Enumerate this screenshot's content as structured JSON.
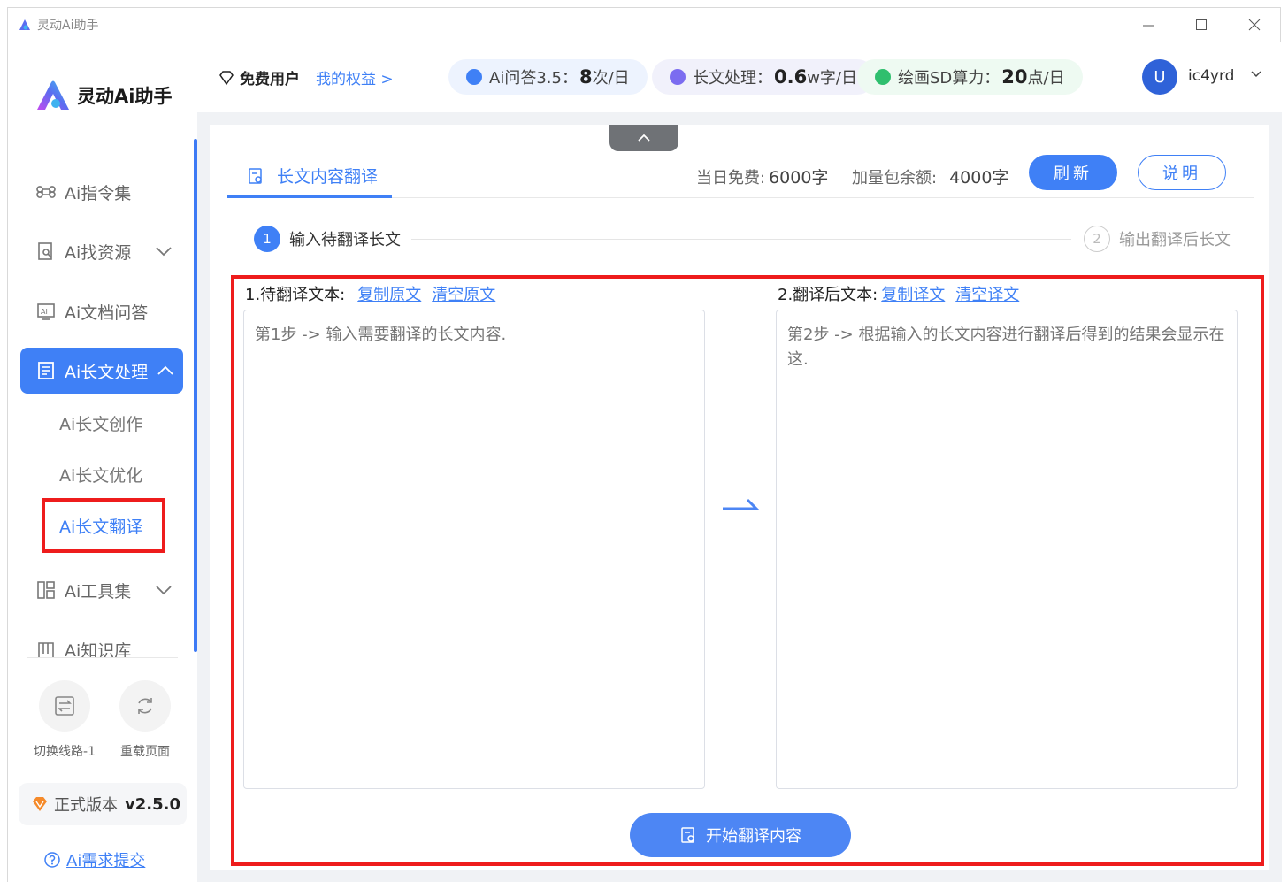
{
  "window": {
    "title": "灵动Ai助手",
    "controls": [
      "minimize-icon",
      "maximize-icon",
      "close-icon"
    ]
  },
  "sidebar": {
    "brand": "灵动Ai助手",
    "items": [
      {
        "label": "Ai指令集",
        "icon": "command-icon"
      },
      {
        "label": "Ai找资源",
        "icon": "search-doc-icon",
        "expandable": true
      },
      {
        "label": "Ai文档问答",
        "icon": "ai-doc-icon"
      },
      {
        "label": "Ai长文处理",
        "icon": "article-icon",
        "expanded": true
      },
      {
        "label": "Ai工具集",
        "icon": "grid-icon",
        "expandable": true
      },
      {
        "label": "Ai知识库",
        "icon": "library-icon"
      }
    ],
    "subitems": [
      "Ai长文创作",
      "Ai长文优化",
      "Ai长文翻译"
    ],
    "switch_line": "切换线路-1",
    "reload_page": "重载页面",
    "version_label": "正式版本",
    "version": "v2.5.0",
    "feedback": "Ai需求提交"
  },
  "topbar": {
    "user_type": "免费用户",
    "rights": "我的权益 >",
    "quotas": [
      {
        "label": "Ai问答3.5：",
        "value": "8",
        "unit": "次/日",
        "color": "#3f80f6",
        "bg": "#edf3fe"
      },
      {
        "label": "长文处理：",
        "value": "0.6",
        "unit": "w字/日",
        "color": "#7b6cf0",
        "bg": "#f1f1fb"
      },
      {
        "label": "绘画SD算力：",
        "value": "20",
        "unit": "点/日",
        "color": "#2fbf6e",
        "bg": "#eefaf2"
      }
    ],
    "avatar_letter": "U",
    "username": "ic4yrd"
  },
  "main": {
    "tab": "长文内容翻译",
    "daily_free_label": "当日免费:",
    "daily_free_value": "6000字",
    "extra_label": "加量包余额:",
    "extra_value": "4000字",
    "refresh": "刷新",
    "explain": "说明",
    "steps": [
      {
        "num": "1",
        "label": "输入待翻译长文"
      },
      {
        "num": "2",
        "label": "输出翻译后长文"
      }
    ],
    "source": {
      "label": "1.待翻译文本:",
      "copy": "复制原文",
      "clear": "清空原文",
      "placeholder": "第1步 -> 输入需要翻译的长文内容."
    },
    "target": {
      "label": "2.翻译后文本:",
      "copy": "复制译文",
      "clear": "清空译文",
      "placeholder": "第2步 -> 根据输入的长文内容进行翻译后得到的结果会显示在这."
    },
    "start_button": "开始翻译内容"
  }
}
